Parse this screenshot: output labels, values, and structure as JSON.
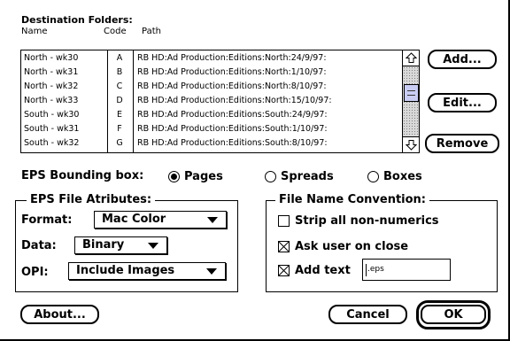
{
  "destination": {
    "title": "Destination Folders:",
    "columns": {
      "name": "Name",
      "code": "Code",
      "path": "Path"
    },
    "rows": [
      {
        "name": "North - wk30",
        "code": "A",
        "path": "RB HD:Ad Production:Editions:North:24/9/97:"
      },
      {
        "name": "North - wk31",
        "code": "B",
        "path": "RB HD:Ad Production:Editions:North:1/10/97:"
      },
      {
        "name": "North - wk32",
        "code": "C",
        "path": "RB HD:Ad Production:Editions:North:8/10/97:"
      },
      {
        "name": "North - wk33",
        "code": "D",
        "path": "RB HD:Ad Production:Editions:North:15/10/97:"
      },
      {
        "name": "South - wk30",
        "code": "E",
        "path": "RB HD:Ad Production:Editions:South:24/9/97:"
      },
      {
        "name": "South - wk31",
        "code": "F",
        "path": "RB HD:Ad Production:Editions:South:1/10/97:"
      },
      {
        "name": "South - wk32",
        "code": "G",
        "path": "RB HD:Ad Production:Editions:South:8/10/97:"
      }
    ],
    "buttons": {
      "add": "Add...",
      "edit": "Edit...",
      "remove": "Remove"
    }
  },
  "bounding_box": {
    "label": "EPS Bounding box:",
    "options": [
      "Pages",
      "Spreads",
      "Boxes"
    ],
    "selected": "Pages"
  },
  "eps_attributes": {
    "title": "EPS File Atributes:",
    "format": {
      "label": "Format:",
      "value": "Mac Color"
    },
    "data": {
      "label": "Data:",
      "value": "Binary"
    },
    "opi": {
      "label": "OPI:",
      "value": "Include Images"
    }
  },
  "file_name": {
    "title": "File Name Convention:",
    "strip": {
      "label": "Strip all non-numerics",
      "checked": false
    },
    "ask": {
      "label": "Ask user on close",
      "checked": true
    },
    "add_text": {
      "label": "Add text",
      "checked": true,
      "value": ".eps"
    }
  },
  "footer": {
    "about": "About...",
    "cancel": "Cancel",
    "ok": "OK"
  },
  "icons": {
    "up": "scroll-up-arrow-icon",
    "down": "scroll-down-arrow-icon",
    "popup": "popup-triangle-icon"
  }
}
